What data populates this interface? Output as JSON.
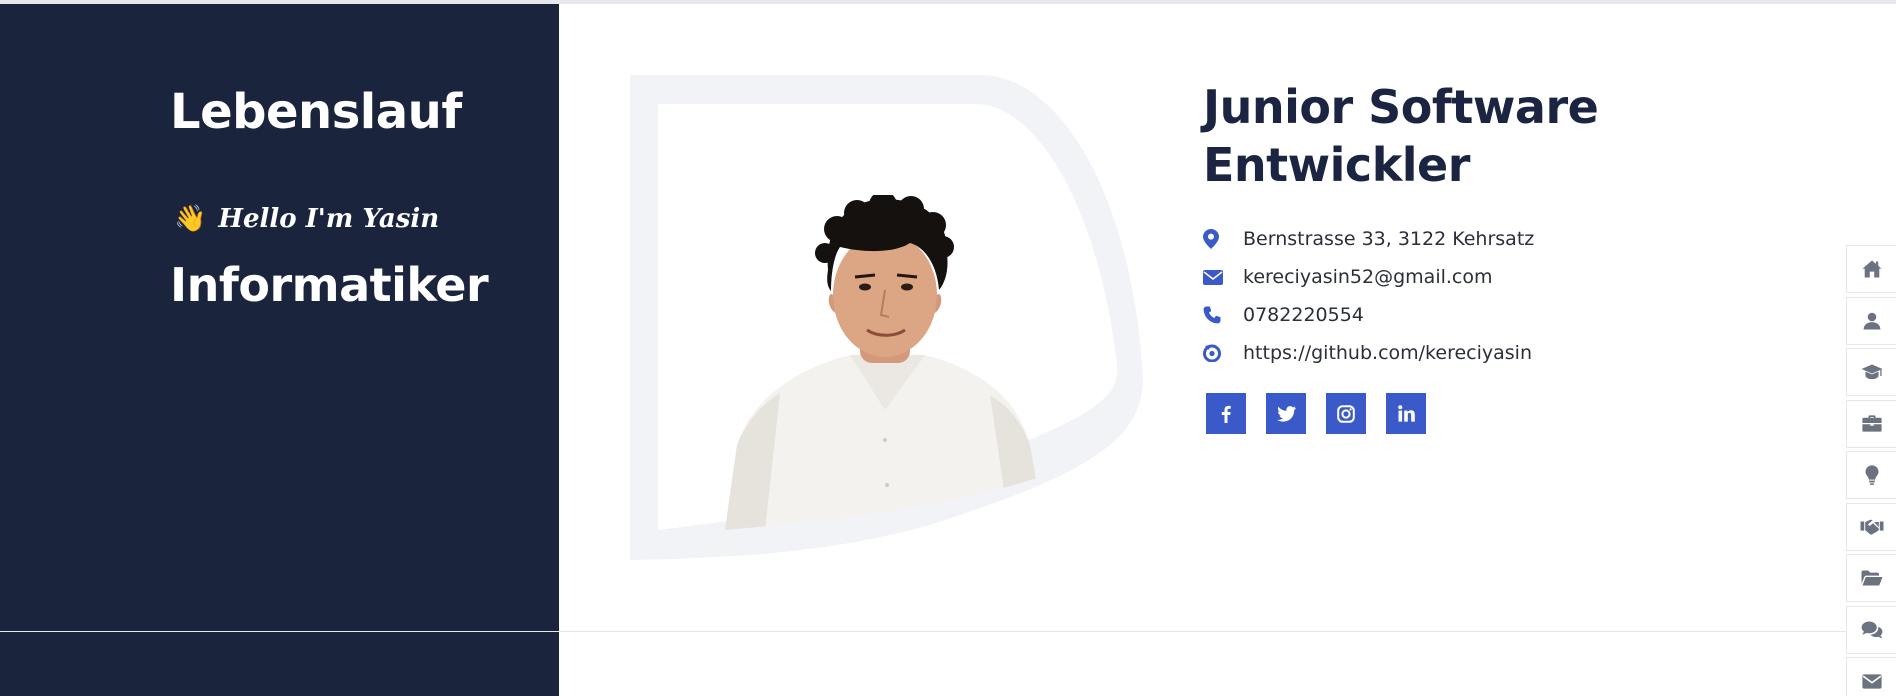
{
  "left": {
    "title": "Lebenslauf",
    "hello_emoji": "👋",
    "hello_text": "Hello I'm Yasin",
    "role": "Informatiker"
  },
  "profile": {
    "job_title_line1": "Junior Software",
    "job_title_line2": "Entwickler"
  },
  "contacts": [
    {
      "icon": "map-pin-icon",
      "text": "Bernstrasse 33, 3122 Kehrsatz"
    },
    {
      "icon": "envelope-icon",
      "text": "kereciyasin52@gmail.com"
    },
    {
      "icon": "phone-icon",
      "text": "0782220554"
    },
    {
      "icon": "github-link-icon",
      "text": "https://github.com/kereciyasin"
    }
  ],
  "socials": [
    {
      "name": "facebook",
      "glyph": "f"
    },
    {
      "name": "twitter",
      "glyph": "t"
    },
    {
      "name": "instagram",
      "glyph": "ig"
    },
    {
      "name": "linkedin",
      "glyph": "in"
    }
  ],
  "sidenav": [
    {
      "icon": "home-icon"
    },
    {
      "icon": "user-icon"
    },
    {
      "icon": "graduation-cap-icon"
    },
    {
      "icon": "briefcase-icon"
    },
    {
      "icon": "lightbulb-icon"
    },
    {
      "icon": "handshake-icon"
    },
    {
      "icon": "folder-open-icon"
    },
    {
      "icon": "comments-icon"
    },
    {
      "icon": "envelope-icon"
    }
  ],
  "colors": {
    "navy": "#1b243d",
    "accent": "#3a5ac9",
    "frame": "#f1f3f7"
  }
}
